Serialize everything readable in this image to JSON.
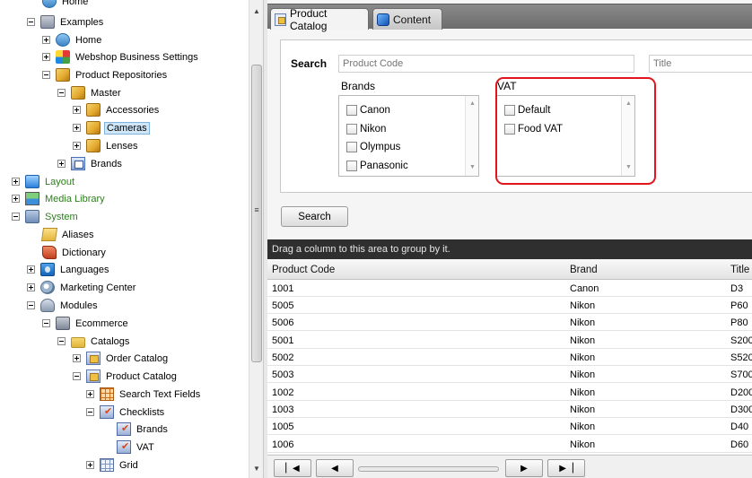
{
  "tree": {
    "items": [
      {
        "label": "Home",
        "icon": "home-icon",
        "expander": "none"
      },
      {
        "label": "Examples",
        "icon": "repository-icon",
        "expander": "minus"
      },
      {
        "label": "Home",
        "icon": "home-icon",
        "expander": "plus"
      },
      {
        "label": "Webshop Business Settings",
        "icon": "settings-icon",
        "expander": "plus"
      },
      {
        "label": "Product Repositories",
        "icon": "cube-icon",
        "expander": "minus"
      },
      {
        "label": "Master",
        "icon": "cube-icon",
        "expander": "minus"
      },
      {
        "label": "Accessories",
        "icon": "cube-icon",
        "expander": "plus"
      },
      {
        "label": "Cameras",
        "icon": "cube-icon",
        "expander": "plus",
        "selected": true
      },
      {
        "label": "Lenses",
        "icon": "cube-icon",
        "expander": "plus"
      },
      {
        "label": "Brands",
        "icon": "brands-icon",
        "expander": "plus"
      },
      {
        "label": "Layout",
        "icon": "layout-icon",
        "expander": "plus"
      },
      {
        "label": "Media Library",
        "icon": "media-library-icon",
        "expander": "plus"
      },
      {
        "label": "System",
        "icon": "system-icon",
        "expander": "minus"
      },
      {
        "label": "Aliases",
        "icon": "aliases-icon",
        "expander": "none"
      },
      {
        "label": "Dictionary",
        "icon": "dictionary-icon",
        "expander": "none"
      },
      {
        "label": "Languages",
        "icon": "languages-icon",
        "expander": "plus"
      },
      {
        "label": "Marketing Center",
        "icon": "marketing-icon",
        "expander": "plus"
      },
      {
        "label": "Modules",
        "icon": "modules-icon",
        "expander": "minus"
      },
      {
        "label": "Ecommerce",
        "icon": "ecommerce-icon",
        "expander": "minus"
      },
      {
        "label": "Catalogs",
        "icon": "folder-icon",
        "expander": "minus"
      },
      {
        "label": "Order Catalog",
        "icon": "catalog-icon",
        "expander": "plus"
      },
      {
        "label": "Product Catalog",
        "icon": "catalog-icon",
        "expander": "minus"
      },
      {
        "label": "Search Text Fields",
        "icon": "grid-orange-icon",
        "expander": "plus"
      },
      {
        "label": "Checklists",
        "icon": "checklist-icon",
        "expander": "minus"
      },
      {
        "label": "Brands",
        "icon": "checklist-icon",
        "expander": "none"
      },
      {
        "label": "VAT",
        "icon": "checklist-icon",
        "expander": "none"
      },
      {
        "label": "Grid",
        "icon": "grid-icon",
        "expander": "plus"
      }
    ]
  },
  "tabs": [
    {
      "label": "Product Catalog",
      "icon": "catalog-tab-icon"
    },
    {
      "label": "Content",
      "icon": "content-tab-icon"
    }
  ],
  "search": {
    "label": "Search",
    "product_code_placeholder": "Product Code",
    "title_placeholder": "Title",
    "button_label": "Search"
  },
  "brands_group": {
    "title": "Brands",
    "options": [
      "Canon",
      "Nikon",
      "Olympus",
      "Panasonic"
    ]
  },
  "vat_group": {
    "title": "VAT",
    "options": [
      "Default",
      "Food VAT"
    ]
  },
  "grid": {
    "group_hint": "Drag a column to this area to group by it.",
    "columns": [
      "Product Code",
      "Brand",
      "Title"
    ],
    "rows": [
      [
        "1001",
        "Canon",
        "D3"
      ],
      [
        "5005",
        "Nikon",
        "P60"
      ],
      [
        "5006",
        "Nikon",
        "P80"
      ],
      [
        "5001",
        "Nikon",
        "S200"
      ],
      [
        "5002",
        "Nikon",
        "S520"
      ],
      [
        "5003",
        "Nikon",
        "S700"
      ],
      [
        "1002",
        "Nikon",
        "D200"
      ],
      [
        "1003",
        "Nikon",
        "D300"
      ],
      [
        "1005",
        "Nikon",
        "D40"
      ],
      [
        "1006",
        "Nikon",
        "D60"
      ]
    ]
  },
  "pager": {
    "first_icon": "first-page-icon",
    "prev_icon": "previous-page-icon",
    "next_icon": "next-page-icon",
    "last_icon": "last-page-icon"
  },
  "colors": {
    "highlight": "#e3141b",
    "group_bar": "#2f2f2f",
    "tree_green_text": "#2e7d1f",
    "selection": "#cfe6f8"
  }
}
